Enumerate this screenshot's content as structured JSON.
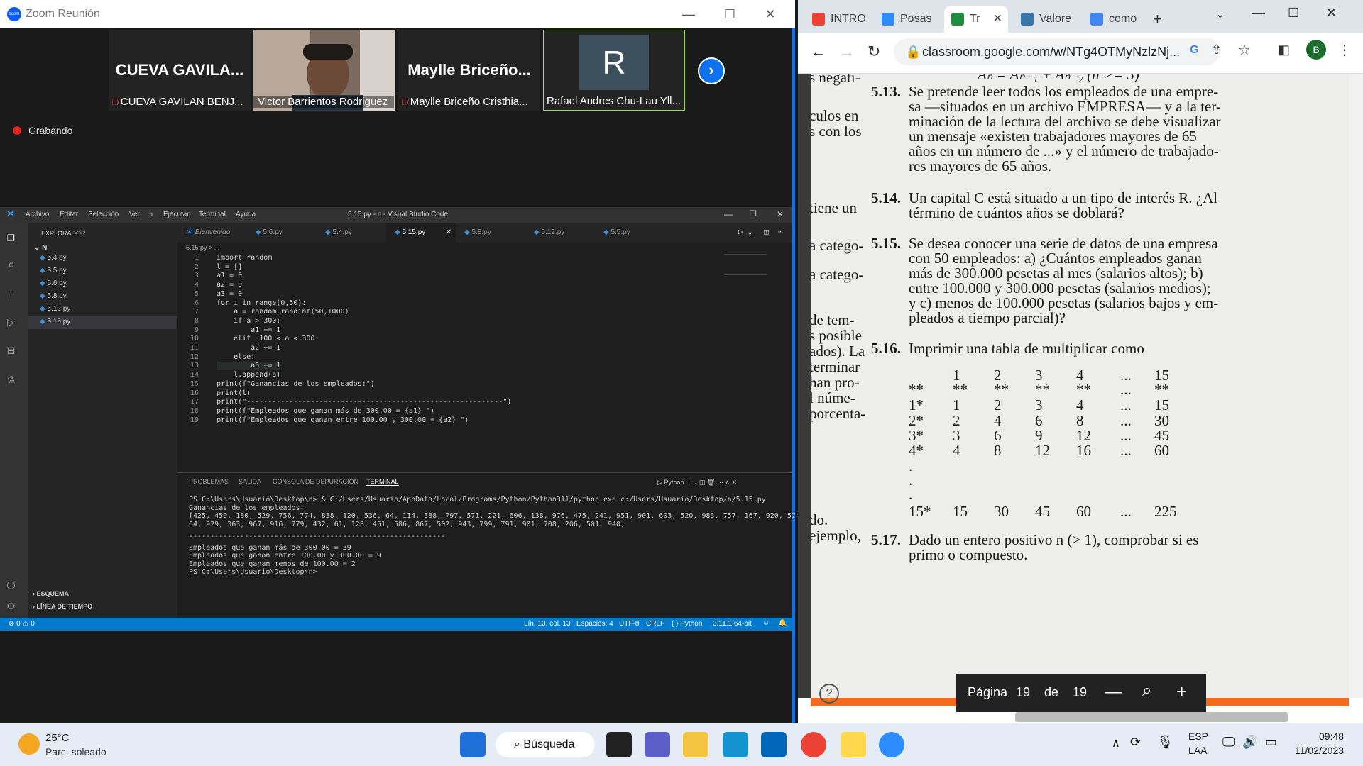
{
  "zoom": {
    "title": "Zoom Reunión",
    "participants": [
      {
        "big": "CUEVA  GAVILA...",
        "caption": "CUEVA GAVILAN BENJ...",
        "muted": true
      },
      {
        "big": "",
        "caption": "Victor Barrientos Rodriguez",
        "muted": false
      },
      {
        "big": "Maylle  Briceño...",
        "caption": "Maylle Briceño Cristhia...",
        "muted": true
      },
      {
        "big": "R",
        "caption": "Rafael Andres Chu-Lau Yll...",
        "muted": false
      }
    ],
    "recording": "Grabando"
  },
  "vscode": {
    "menu": [
      "Archivo",
      "Editar",
      "Selección",
      "Ver",
      "Ir",
      "Ejecutar",
      "Terminal",
      "Ayuda"
    ],
    "title": "5.15.py - n - Visual Studio Code",
    "explorer_label": "EXPLORADOR",
    "folder": "N",
    "files": [
      "5.4.py",
      "5.5.py",
      "5.6.py",
      "5.8.py",
      "5.12.py",
      "5.15.py"
    ],
    "tabs": [
      "Bienvenido",
      "5.6.py",
      "5.4.py",
      "5.15.py",
      "5.8.py",
      "5.12.py",
      "5.5.py"
    ],
    "breadcrumb": "5.15.py > ...",
    "code": [
      "import random",
      "l = []",
      "a1 = 0",
      "a2 = 0",
      "a3 = 0",
      "for i in range(0,50):",
      "    a = random.randint(50,1000)",
      "    if a > 300:",
      "        a1 += 1",
      "    elif  100 < a < 300:",
      "        a2 += 1",
      "    else:",
      "        a3 += 1",
      "    l.append(a)",
      "print(f\"Ganancias de los empleados:\")",
      "print(l)",
      "print(\"------------------------------------------------------------\")",
      "print(f\"Empleados que ganan más de 300.00 = {a1} \")",
      "print(f\"Empleados que ganan entre 100.00 y 300.00 = {a2} \")"
    ],
    "panel_tabs": [
      "PROBLEMAS",
      "SALIDA",
      "CONSOLA DE DEPURACIÓN",
      "TERMINAL"
    ],
    "terminal_shell": "Python",
    "terminal": [
      "PS C:\\Users\\Usuario\\Desktop\\n> & C:/Users/Usuario/AppData/Local/Programs/Python/Python311/python.exe c:/Users/Usuario/Desktop/n/5.15.py",
      "Ganancias de los empleados:",
      "[425, 459, 180, 529, 756, 774, 838, 120, 536, 64, 114, 388, 797, 571, 221, 606, 138, 976, 475, 241, 951, 901, 603, 520, 983, 757, 167, 920, 574, 6",
      "64, 929, 363, 967, 916, 779, 432, 61, 128, 451, 586, 867, 502, 943, 799, 791, 901, 708, 206, 501, 940]",
      "------------------------------------------------------------",
      "Empleados que ganan más de 300.00 = 39",
      "Empleados que ganan entre 100.00 y 300.00 = 9",
      "Empleados que ganan menos de 100.00 = 2",
      "PS C:\\Users\\Usuario\\Desktop\\n> "
    ],
    "outline": "ESQUEMA",
    "timeline": "LÍNEA DE TIEMPO",
    "status_left": "⊗ 0 ⚠ 0",
    "status_items": [
      "Lín. 13, col. 13",
      "Espacios: 4",
      "UTF-8",
      "CRLF",
      "Python",
      "3.11.1 64-bit"
    ]
  },
  "chrome": {
    "tabs": [
      "INTRO",
      "Posas",
      "Tr",
      "Valore",
      "como"
    ],
    "url": "classroom.google.com/w/NTg4OTMyNzlzNj...",
    "left_fragments": [
      "s negati-",
      "culos en",
      "s con los",
      "tiene un",
      "a catego-",
      "a catego-",
      "de tem-",
      "s posible",
      "ados). La",
      "terminar",
      "han pro-",
      "l núme-",
      "porcenta-",
      "do.",
      "ejemplo,"
    ],
    "formula": "Aₙ = Aₙ₋₁ + Aₙ₋₂ (n >= 3)",
    "problems": [
      {
        "num": "5.13.",
        "lines": [
          "Se pretende leer todos los empleados de una empre-",
          "sa —situados en un archivo EMPRESA— y a la ter-",
          "minación de la lectura del archivo se debe visualizar",
          "un mensaje «existen trabajadores mayores de 65",
          "años en un número de ...» y el número de trabajado-",
          "res mayores de 65 años."
        ]
      },
      {
        "num": "5.14.",
        "lines": [
          "Un capital C está situado a un tipo de interés R. ¿Al",
          "término de cuántos años se doblará?"
        ]
      },
      {
        "num": "5.15.",
        "lines": [
          "Se desea conocer una serie de datos de una empresa",
          "con 50 empleados: a) ¿Cuántos empleados ganan",
          "más de 300.000 pesetas al mes (salarios altos); b)",
          "entre 100.000 y 300.000 pesetas (salarios medios);",
          "y c) menos de 100.000 pesetas (salarios bajos y em-",
          "pleados a tiempo parcial)?"
        ]
      },
      {
        "num": "5.16.",
        "lines": [
          "Imprimir una tabla de multiplicar como"
        ]
      },
      {
        "num": "5.17.",
        "lines": [
          "Dado un entero positivo n (> 1), comprobar si es",
          "primo o compuesto."
        ]
      }
    ],
    "table": [
      [
        "",
        "1",
        "2",
        "3",
        "4",
        "...",
        "15"
      ],
      [
        "**",
        "**",
        "**",
        "**",
        "**",
        "...",
        "**"
      ],
      [
        "1*",
        "1",
        "2",
        "3",
        "4",
        "...",
        "15"
      ],
      [
        "2*",
        "2",
        "4",
        "6",
        "8",
        "...",
        "30"
      ],
      [
        "3*",
        "3",
        "6",
        "9",
        "12",
        "...",
        "45"
      ],
      [
        "4*",
        "4",
        "8",
        "12",
        "16",
        "...",
        "60"
      ],
      [
        ".",
        "",
        "",
        "",
        "",
        "",
        ""
      ],
      [
        ".",
        "",
        "",
        "",
        "",
        "",
        ""
      ],
      [
        ".",
        "",
        "",
        "",
        "",
        "",
        ""
      ],
      [
        "15*",
        "15",
        "30",
        "45",
        "60",
        "...",
        "225"
      ]
    ],
    "pager": {
      "label": "Página",
      "current": "19",
      "of": "de",
      "total": "19"
    }
  },
  "taskbar": {
    "weather_temp": "25°C",
    "weather_desc": "Parc. soleado",
    "search": "Búsqueda",
    "lang1": "ESP",
    "lang2": "LAA",
    "time": "09:48",
    "date": "11/02/2023"
  }
}
